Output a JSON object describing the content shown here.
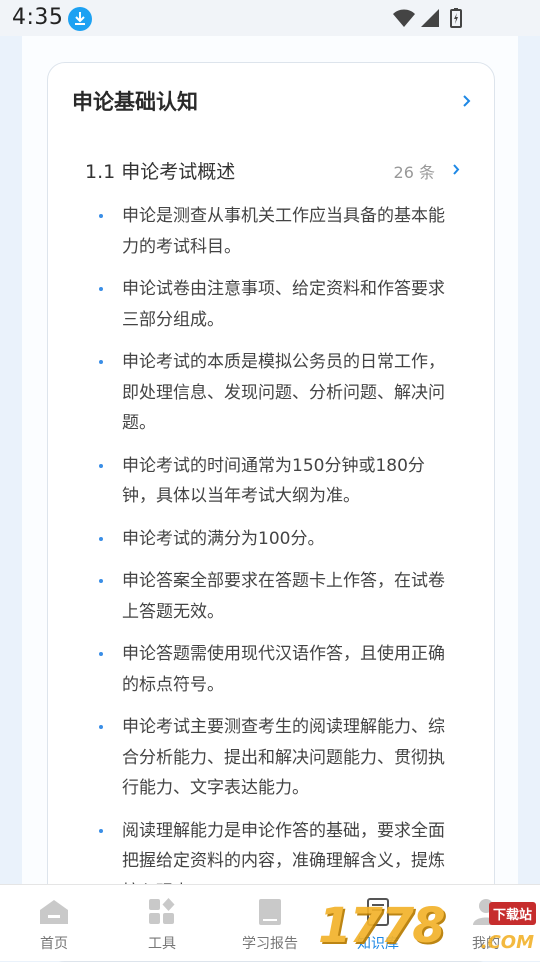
{
  "status": {
    "time": "4:35"
  },
  "card": {
    "title": "申论基础认知"
  },
  "section": {
    "title": "1.1 申论考试概述",
    "count": "26 条"
  },
  "items": [
    "申论是测查从事机关工作应当具备的基本能力的考试科目。",
    "申论试卷由注意事项、给定资料和作答要求三部分组成。",
    "申论考试的本质是模拟公务员的日常工作，即处理信息、发现问题、分析问题、解决问题。",
    "申论考试的时间通常为150分钟或180分钟，具体以当年考试大纲为准。",
    "申论考试的满分为100分。",
    "申论答案全部要求在答题卡上作答，在试卷上答题无效。",
    "申论答题需使用现代汉语作答，且使用正确的标点符号。",
    "申论考试主要测查考生的阅读理解能力、综合分析能力、提出和解决问题能力、贯彻执行能力、文字表达能力。",
    "阅读理解能力是申论作答的基础，要求全面把握给定资料的内容，准确理解含义，提炼核心观点。"
  ],
  "nav": [
    {
      "label": "首页",
      "icon": "home-icon"
    },
    {
      "label": "工具",
      "icon": "tools-icon"
    },
    {
      "label": "学习报告",
      "icon": "report-icon"
    },
    {
      "label": "知识库",
      "icon": "knowledge-icon"
    },
    {
      "label": "我的",
      "icon": "profile-icon"
    }
  ],
  "watermark": {
    "text": "1778",
    "badge": "下载站",
    "domain": ".COM"
  },
  "colors": {
    "accent": "#1e88e5",
    "bullet": "#3a8ee6",
    "background": "#eaf2fb"
  }
}
